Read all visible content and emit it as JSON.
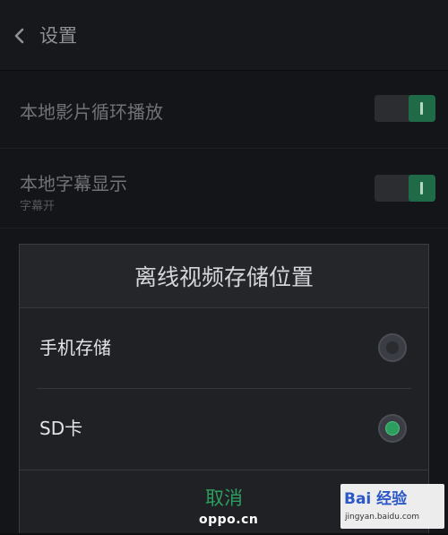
{
  "header": {
    "title": "设置"
  },
  "settings": {
    "items": [
      {
        "title": "本地影片循环播放",
        "subtitle": "",
        "toggle_on": true
      },
      {
        "title": "本地字幕显示",
        "subtitle": "字幕开",
        "toggle_on": true
      }
    ]
  },
  "dialog": {
    "title": "离线视频存储位置",
    "options": [
      {
        "label": "手机存储",
        "selected": false
      },
      {
        "label": "SD卡",
        "selected": true
      }
    ],
    "cancel_label": "取消"
  },
  "watermarks": {
    "oppo": "oppo.cn",
    "baidu_brand": "Bai 经验",
    "baidu_url": "jingyan.baidu.com"
  },
  "colors": {
    "accent": "#2e9e5f",
    "background": "#141518",
    "dialog": "#1f2124"
  },
  "icons": {
    "back": "chevron-left-icon",
    "paw": "paw-icon"
  }
}
